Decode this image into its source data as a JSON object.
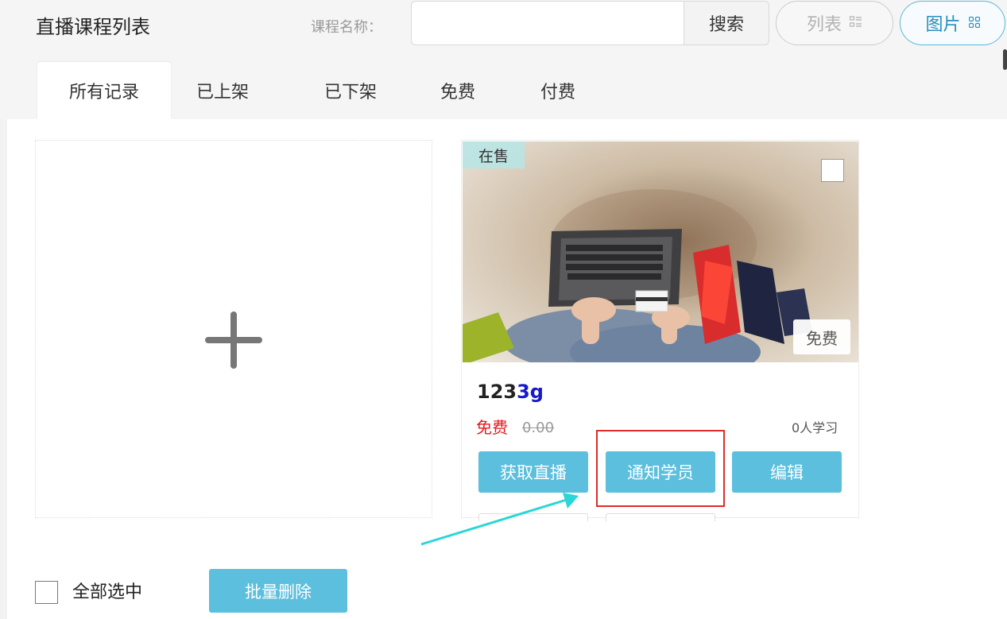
{
  "header": {
    "title": "直播课程列表",
    "search_label": "课程名称：",
    "search_value": "",
    "search_placeholder": "",
    "search_button": "搜索",
    "view_list_label": "列表",
    "view_grid_label": "图片",
    "view_list_icon": "list-icon",
    "view_grid_icon": "grid-icon"
  },
  "tabs": [
    {
      "label": "所有记录",
      "active": true
    },
    {
      "label": "已上架",
      "active": false
    },
    {
      "label": "已下架",
      "active": false
    },
    {
      "label": "免费",
      "active": false
    },
    {
      "label": "付费",
      "active": false
    }
  ],
  "add_card": {
    "icon": "plus-icon"
  },
  "course": {
    "status_badge": "在售",
    "price_tag": "免费",
    "title_main": "123",
    "title_accent": "3g",
    "price_label": "免费",
    "original_price": "0.00",
    "learners": "0人学习",
    "actions": [
      "获取直播",
      "通知学员",
      "编辑"
    ]
  },
  "footer": {
    "select_all_label": "全部选中",
    "batch_delete_label": "批量删除"
  },
  "colors": {
    "accent_button": "#5bbfdd",
    "price_red": "#e4181b",
    "title_accent": "#1818cc",
    "highlight_box": "#e02b2b",
    "arrow": "#2ad6d6"
  }
}
